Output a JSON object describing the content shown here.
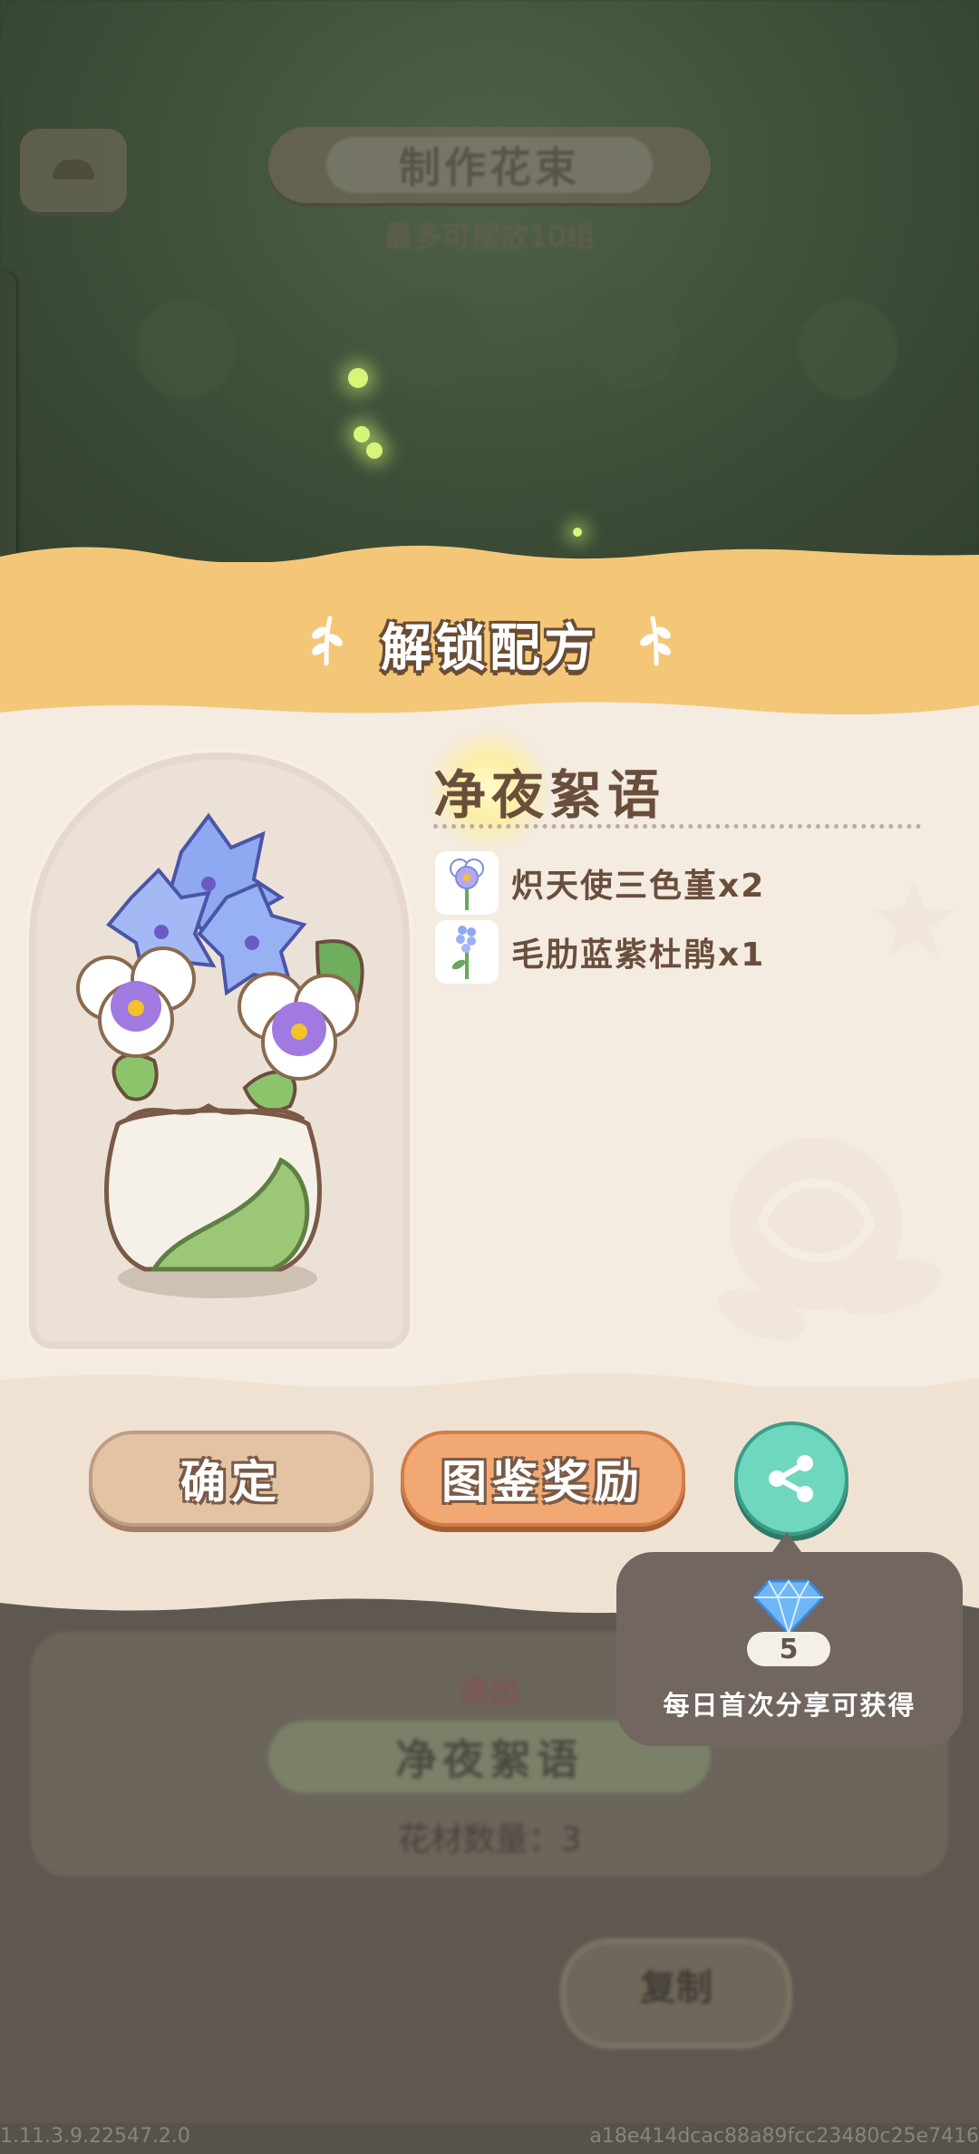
{
  "background": {
    "title": "制作花束",
    "subtitle": "最多可摆放10组",
    "card_label": "造出",
    "card_name": "净夜絮语",
    "card_count": "花材数量：3",
    "button": "复制"
  },
  "popup": {
    "title": "解锁配方",
    "recipe_name": "净夜絮语",
    "ingredients": [
      {
        "name": "炽天使三色堇x2",
        "icon": "pansy-icon"
      },
      {
        "name": "毛肋蓝紫杜鹃x1",
        "icon": "azalea-icon"
      }
    ],
    "buttons": {
      "confirm": "确定",
      "reward": "图鉴奖励",
      "share": "share-icon"
    }
  },
  "tooltip": {
    "gem_count": "5",
    "text": "每日首次分享可获得"
  },
  "footer": {
    "version": "1.11.3.9.22547.2.0",
    "hash": "a18e414dcac88a89fcc23480c25e7416"
  },
  "colors": {
    "band": "#f3c777",
    "panel": "#f4ebe1",
    "confirm": "#e2c4a4",
    "reward": "#f2a872",
    "share": "#6fd7bd",
    "tooltip": "#716760"
  }
}
